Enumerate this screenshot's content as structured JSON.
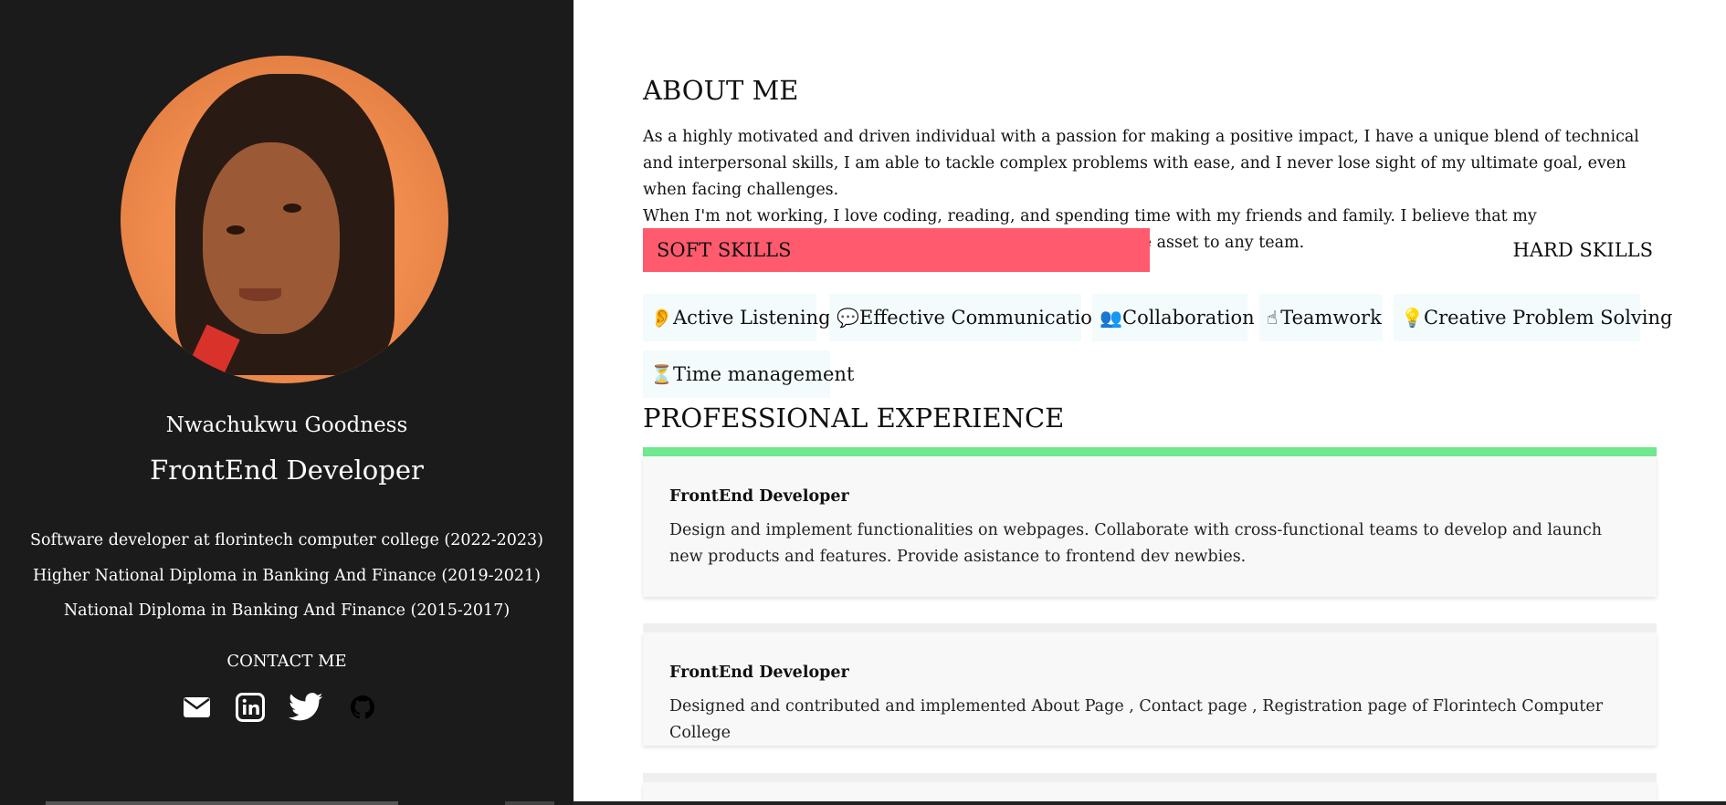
{
  "profile": {
    "name": "Nwachukwu Goodness",
    "role": "FrontEnd Developer",
    "history": [
      "Software developer at florintech computer college (2022-2023)",
      "Higher National Diploma in Banking And Finance (2019-2021)",
      "National Diploma in Banking And Finance (2015-2017)"
    ],
    "contact_title": "CONTACT ME",
    "socials": [
      "mail-icon",
      "linkedin-icon",
      "twitter-icon",
      "github-icon"
    ]
  },
  "about": {
    "title": "ABOUT ME",
    "paragraph1": "As a highly motivated and driven individual with a passion for making a positive impact, I have a unique blend of technical and interpersonal skills, I am able to tackle complex problems with ease, and I never lose sight of my ultimate goal, even when facing challenges.",
    "paragraph2": "When I'm not working, I love coding, reading, and spending time with my friends and family. I believe that my determination, can-do attitude, and hard work make me a true asset to any team."
  },
  "skills": {
    "soft_label": "SOFT SKILLS",
    "hard_label": "HARD SKILLS",
    "active_color": "#ff5a6e",
    "chips": [
      {
        "icon": "ear-icon",
        "glyph": "👂",
        "label": "Active Listening"
      },
      {
        "icon": "speech-bubble-icon",
        "glyph": "💬",
        "label": "Effective Communication"
      },
      {
        "icon": "people-icon",
        "glyph": "👥",
        "label": "Collaboration"
      },
      {
        "icon": "hands-icon",
        "glyph": "☝",
        "label": "Teamwork"
      },
      {
        "icon": "lightbulb-icon",
        "glyph": "💡",
        "label": "Creative Problem Solving"
      },
      {
        "icon": "hourglass-icon",
        "glyph": "⏳",
        "label": "Time management"
      }
    ]
  },
  "experience": {
    "title": "PROFESSIONAL EXPERIENCE",
    "accent_color": "#6fe88e",
    "items": [
      {
        "title": "FrontEnd Developer",
        "description": "Design and implement functionalities on webpages. Collaborate with cross-functional teams to develop and launch new products and features. Provide asistance to frontend dev newbies."
      },
      {
        "title": "FrontEnd Developer",
        "description": "Designed and contributed and implemented About Page , Contact page , Registration page of Florintech Computer College"
      }
    ]
  }
}
